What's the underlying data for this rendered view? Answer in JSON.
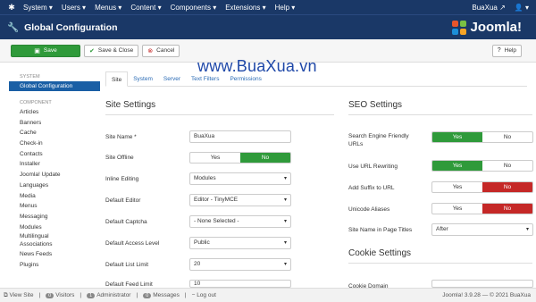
{
  "topnav": {
    "menu": [
      "System",
      "Users",
      "Menus",
      "Content",
      "Components",
      "Extensions",
      "Help"
    ],
    "site": "BuaXua",
    "user_icon": "user-icon"
  },
  "title": "Global Configuration",
  "brand": "Joomla!",
  "toolbar": {
    "save": "Save",
    "save_close": "Save & Close",
    "cancel": "Cancel",
    "help": "Help"
  },
  "watermark": "www.BuaXua.vn",
  "sidebar": {
    "system_head": "SYSTEM",
    "active": "Global Configuration",
    "component_head": "COMPONENT",
    "items": [
      "Articles",
      "Banners",
      "Cache",
      "Check-in",
      "Contacts",
      "Installer",
      "Joomla! Update",
      "Languages",
      "Media",
      "Menus",
      "Messaging",
      "Modules",
      "Multilingual",
      "Associations",
      "News Feeds",
      "Plugins"
    ]
  },
  "tabs": [
    "Site",
    "System",
    "Server",
    "Text Filters",
    "Permissions"
  ],
  "site_settings": {
    "title": "Site Settings",
    "site_name_label": "Site Name *",
    "site_name_value": "BuaXua",
    "offline_label": "Site Offline",
    "offline_yes": "Yes",
    "offline_no": "No",
    "inline_label": "Inline Editing",
    "inline_value": "Modules",
    "editor_label": "Default Editor",
    "editor_value": "Editor - TinyMCE",
    "captcha_label": "Default Captcha",
    "captcha_value": "- None Selected -",
    "access_label": "Default Access Level",
    "access_value": "Public",
    "list_label": "Default List Limit",
    "list_value": "20",
    "feed_label": "Default Feed Limit",
    "feed_value": "10"
  },
  "seo_settings": {
    "title": "SEO Settings",
    "sef_label_1": "Search Engine Friendly",
    "sef_label_2": "URLs",
    "rewrite_label": "Use URL Rewriting",
    "suffix_label": "Add Suffix to URL",
    "unicode_label": "Unicode Aliases",
    "sitename_label": "Site Name in Page Titles",
    "sitename_value": "After",
    "yes": "Yes",
    "no": "No"
  },
  "cookie": {
    "title": "Cookie Settings",
    "domain_label": "Cookie Domain"
  },
  "status": {
    "view_site": "View Site",
    "visitors_count": "0",
    "visitors": "Visitors",
    "admin_count": "1",
    "admin": "Administrator",
    "messages_count": "0",
    "messages": "Messages",
    "logout": "Log out",
    "version": "Joomla! 3.9.28 — © 2021 BuaXua"
  },
  "colors": {
    "nav": "#1a3867",
    "green": "#2f9a3a",
    "red": "#c52827",
    "active": "#1a5fa5"
  }
}
